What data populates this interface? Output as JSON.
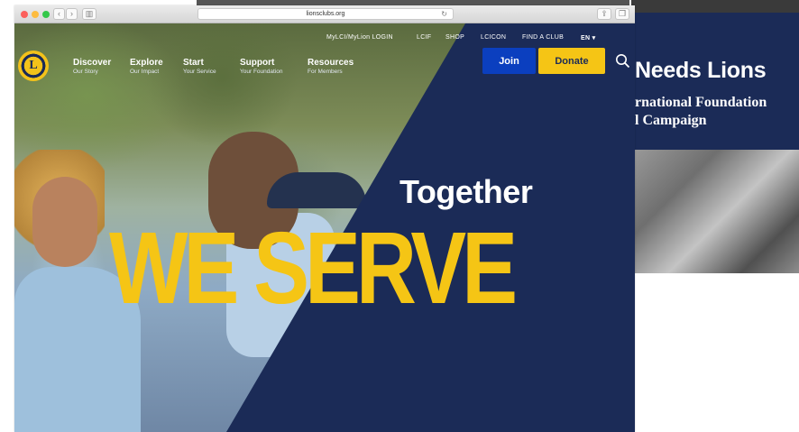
{
  "browser": {
    "url": "lionsclubs.org"
  },
  "header": {
    "logo_text": "L",
    "utility_links": [
      "MyLCI/MyLion LOGIN",
      "LCIF",
      "SHOP",
      "LCICON",
      "FIND A CLUB"
    ],
    "language": "EN ▾",
    "nav": [
      {
        "title": "Discover",
        "subtitle": "Our Story"
      },
      {
        "title": "Explore",
        "subtitle": "Our Impact"
      },
      {
        "title": "Start",
        "subtitle": "Your Service"
      },
      {
        "title": "Support",
        "subtitle": "Your Foundation"
      },
      {
        "title": "Resources",
        "subtitle": "For Members"
      }
    ],
    "join_label": "Join",
    "donate_label": "Donate",
    "search_icon": "search-icon"
  },
  "hero": {
    "together": "Together",
    "we_serve": "WE SERVE"
  },
  "background_page": {
    "title": "Needs Lions",
    "subtitle_line1": "rnational Foundation",
    "subtitle_line2": "l Campaign"
  },
  "colors": {
    "navy": "#1b2b57",
    "gold": "#f5c515",
    "join_blue": "#0b3fbf"
  }
}
